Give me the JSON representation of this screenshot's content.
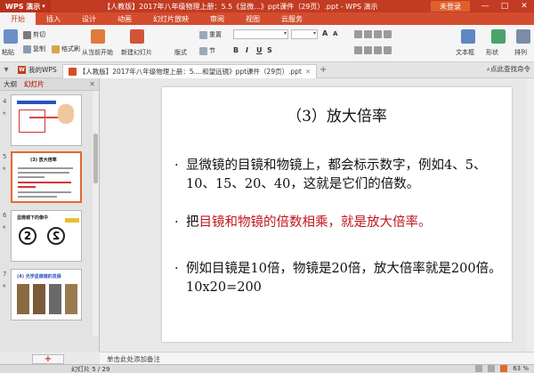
{
  "titlebar": {
    "app": "WPS 演示",
    "document": "【人教版】2017年八年级物理上册：5.5《显微...》ppt课件（29页）.ppt - WPS 演示",
    "login": "未登录",
    "minimize": "—",
    "maximize": "□",
    "close": "✕"
  },
  "menu": {
    "items": [
      "开始",
      "插入",
      "设计",
      "动画",
      "幻灯片放映",
      "审阅",
      "视图",
      "云服务"
    ]
  },
  "ribbon": {
    "paste": "粘贴",
    "cut": "剪切",
    "copy": "复制",
    "format_painter": "格式刷",
    "from_current": "从当前开始",
    "new_slide": "新建幻灯片",
    "layout": "版式",
    "reset": "重置",
    "section": "节",
    "textbox": "文本框",
    "shape": "形状",
    "arrange": "排列",
    "font_bold": "B",
    "font_italic": "I",
    "font_underline": "U",
    "font_shadow": "S",
    "size_up": "A",
    "size_down": "A"
  },
  "tabs": {
    "home": "我的WPS",
    "document": "【人教版】2017年八年级物理上册：5....和望远镜》ppt课件（29页）.ppt",
    "search_hint": "点此查找命令"
  },
  "sidebar": {
    "outline_tab": "大纲",
    "slides_tab": "幻灯片",
    "slide_numbers": [
      "4",
      "5",
      "6",
      "7"
    ],
    "thumb5_title": "(3) 放大倍率",
    "thumb6_title": "显微镜下的像中",
    "thumb7_title": "(4) 光学显微镜的发展"
  },
  "slide": {
    "title": "（3）放大倍率",
    "bullet1": "显微镜的目镜和物镜上，都会标示数字，例如4、5、10、15、20、40，这就是它们的倍数。",
    "bullet2_prefix": "把",
    "bullet2_red": "目镜和物镜的倍数相乘，就是放大倍率。",
    "bullet3": "例如目镜是10倍，物镜是20倍，放大倍率就是200倍。10x20=200",
    "bullet_mark": "·"
  },
  "notes": {
    "placeholder": "单击此处添加备注"
  },
  "status": {
    "slide_info": "幻灯片 5 / 29",
    "zoom": "63 %"
  }
}
